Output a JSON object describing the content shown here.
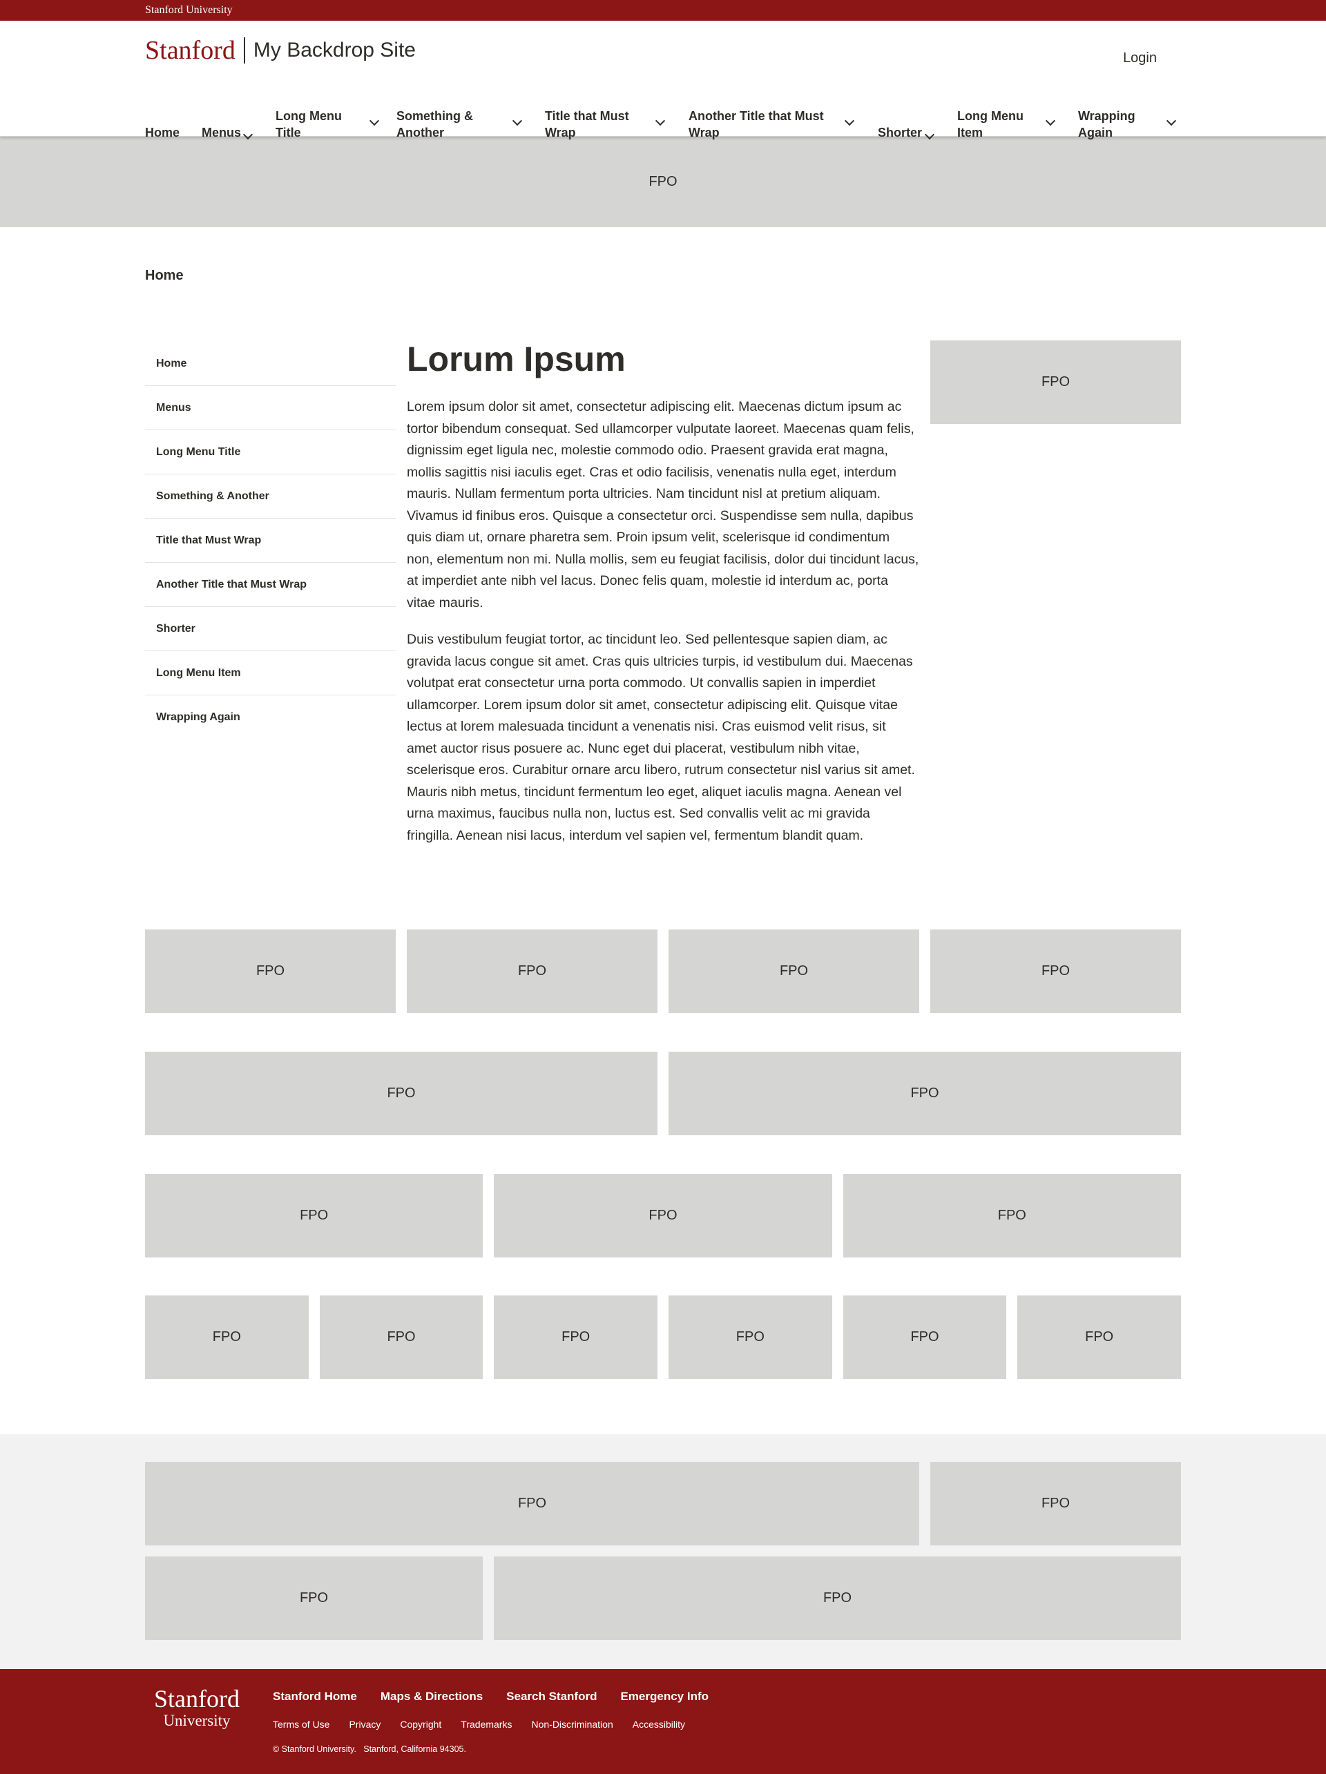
{
  "brandbar": {
    "label": "Stanford University"
  },
  "header": {
    "logo_word": "Stanford",
    "site_name": "My Backdrop Site",
    "login_label": "Login"
  },
  "mainnav": {
    "items": [
      {
        "label": "Home",
        "has_dropdown": false
      },
      {
        "label": "Menus",
        "has_dropdown": true
      },
      {
        "label": "Long Menu Title",
        "has_dropdown": true
      },
      {
        "label": "Something & Another",
        "has_dropdown": true
      },
      {
        "label": "Title that Must Wrap",
        "has_dropdown": true
      },
      {
        "label": "Another Title that Must Wrap",
        "has_dropdown": true
      },
      {
        "label": "Shorter",
        "has_dropdown": true
      },
      {
        "label": "Long Menu Item",
        "has_dropdown": true
      },
      {
        "label": "Wrapping Again",
        "has_dropdown": true
      }
    ]
  },
  "placeholder_label": "FPO",
  "breadcrumb": {
    "current": "Home"
  },
  "sidenav": {
    "items": [
      "Home",
      "Menus",
      "Long Menu Title",
      "Something & Another",
      "Title that Must Wrap",
      "Another Title that Must Wrap",
      "Shorter",
      "Long Menu Item",
      "Wrapping Again"
    ]
  },
  "main": {
    "title": "Lorum Ipsum",
    "paragraphs": [
      "Lorem ipsum dolor sit amet, consectetur adipiscing elit. Maecenas dictum ipsum ac tortor bibendum consequat. Sed ullamcorper vulputate laoreet. Maecenas quam felis, dignissim eget ligula nec, molestie commodo odio. Praesent gravida erat magna, mollis sagittis nisi iaculis eget. Cras et odio facilisis, venenatis nulla eget, interdum mauris. Nullam fermentum porta ultricies. Nam tincidunt nisl at pretium aliquam. Vivamus id finibus eros. Quisque a consectetur orci. Suspendisse sem nulla, dapibus quis diam ut, ornare pharetra sem. Proin ipsum velit, scelerisque id condimentum non, elementum non mi. Nulla mollis, sem eu feugiat facilisis, dolor dui tincidunt lacus, at imperdiet ante nibh vel lacus. Donec felis quam, molestie id interdum ac, porta vitae mauris.",
      "Duis vestibulum feugiat tortor, ac tincidunt leo. Sed pellentesque sapien diam, ac gravida lacus congue sit amet. Cras quis ultricies turpis, id vestibulum dui. Maecenas volutpat erat consectetur urna porta commodo. Ut convallis sapien in imperdiet ullamcorper. Lorem ipsum dolor sit amet, consectetur adipiscing elit. Quisque vitae lectus at lorem malesuada tincidunt a venenatis nisi. Cras euismod velit risus, sit amet auctor risus posuere ac. Nunc eget dui placerat, vestibulum nibh vitae, scelerisque eros. Curabitur ornare arcu libero, rutrum consectetur nisl varius sit amet. Mauris nibh metus, tincidunt fermentum leo eget, aliquet iaculis magna. Aenean vel urna maximus, faucibus nulla non, luctus est. Sed convallis velit ac mi gravida fringilla. Aenean nisi lacus, interdum vel sapien vel, fermentum blandit quam."
    ]
  },
  "footer": {
    "logo_line1": "Stanford",
    "logo_line2": "University",
    "primary_links": [
      "Stanford Home",
      "Maps & Directions",
      "Search Stanford",
      "Emergency Info"
    ],
    "secondary_links": [
      "Terms of Use",
      "Privacy",
      "Copyright",
      "Trademarks",
      "Non-Discrimination",
      "Accessibility"
    ],
    "copyright": "© Stanford University.   Stanford, California 94305."
  },
  "colors": {
    "brand_red": "#8c1515",
    "placeholder_gray": "#d5d5d4",
    "light_section": "#f2f2f3",
    "text": "#2e2d29"
  }
}
